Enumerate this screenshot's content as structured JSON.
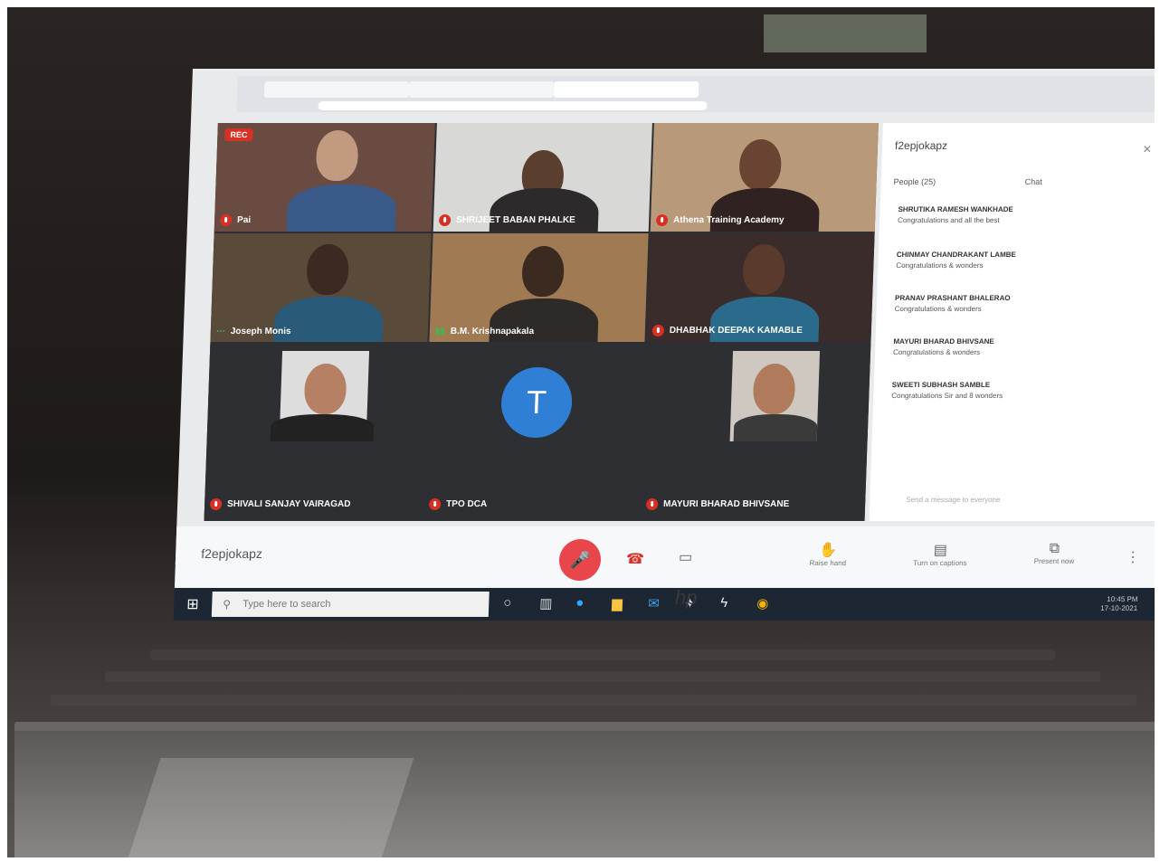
{
  "meeting": {
    "rec_badge": "REC",
    "code": "f2epjokapz",
    "participants": [
      {
        "name": "Pai"
      },
      {
        "name": "SHRIJEET BABAN PHALKE"
      },
      {
        "name": "Athena Training Academy"
      },
      {
        "name": "Joseph Monis"
      },
      {
        "name": "B.M. Krishnapakala"
      },
      {
        "name": "DHABHAK DEEPAK KAMABLE"
      },
      {
        "name": "SHIVALI SANJAY VAIRAGAD"
      },
      {
        "name": "TPO DCA",
        "avatar_letter": "T"
      },
      {
        "name": "MAYURI BHARAD BHIVSANE"
      }
    ]
  },
  "panel": {
    "title": "f2epjokapz",
    "close": "✕",
    "tab_people": "People (25)",
    "tab_chat": "Chat",
    "messages": [
      {
        "sender": "SHRUTIKA RAMESH WANKHADE",
        "text": "Congratulations and all the best"
      },
      {
        "sender": "CHINMAY CHANDRAKANT LAMBE",
        "text": "Congratulations & wonders"
      },
      {
        "sender": "PRANAV PRASHANT BHALERAO",
        "text": "Congratulations & wonders"
      },
      {
        "sender": "MAYURI BHARAD BHIVSANE",
        "text": "Congratulations & wonders"
      },
      {
        "sender": "SWEETI SUBHASH SAMBLE",
        "text": "Congratulations Sir and 8 wonders"
      }
    ],
    "send_placeholder": "Send a message to everyone"
  },
  "controls": {
    "raise_hand": "Raise hand",
    "captions": "Turn on captions",
    "present": "Present now",
    "hang_icon": "☎",
    "cam_icon": "▭",
    "more_icon": "⋮",
    "mic_icon": "🎤"
  },
  "taskbar": {
    "search_placeholder": "Type here to search",
    "time": "10:45 PM",
    "date": "17-10-2021"
  },
  "laptop_brand": "hp"
}
